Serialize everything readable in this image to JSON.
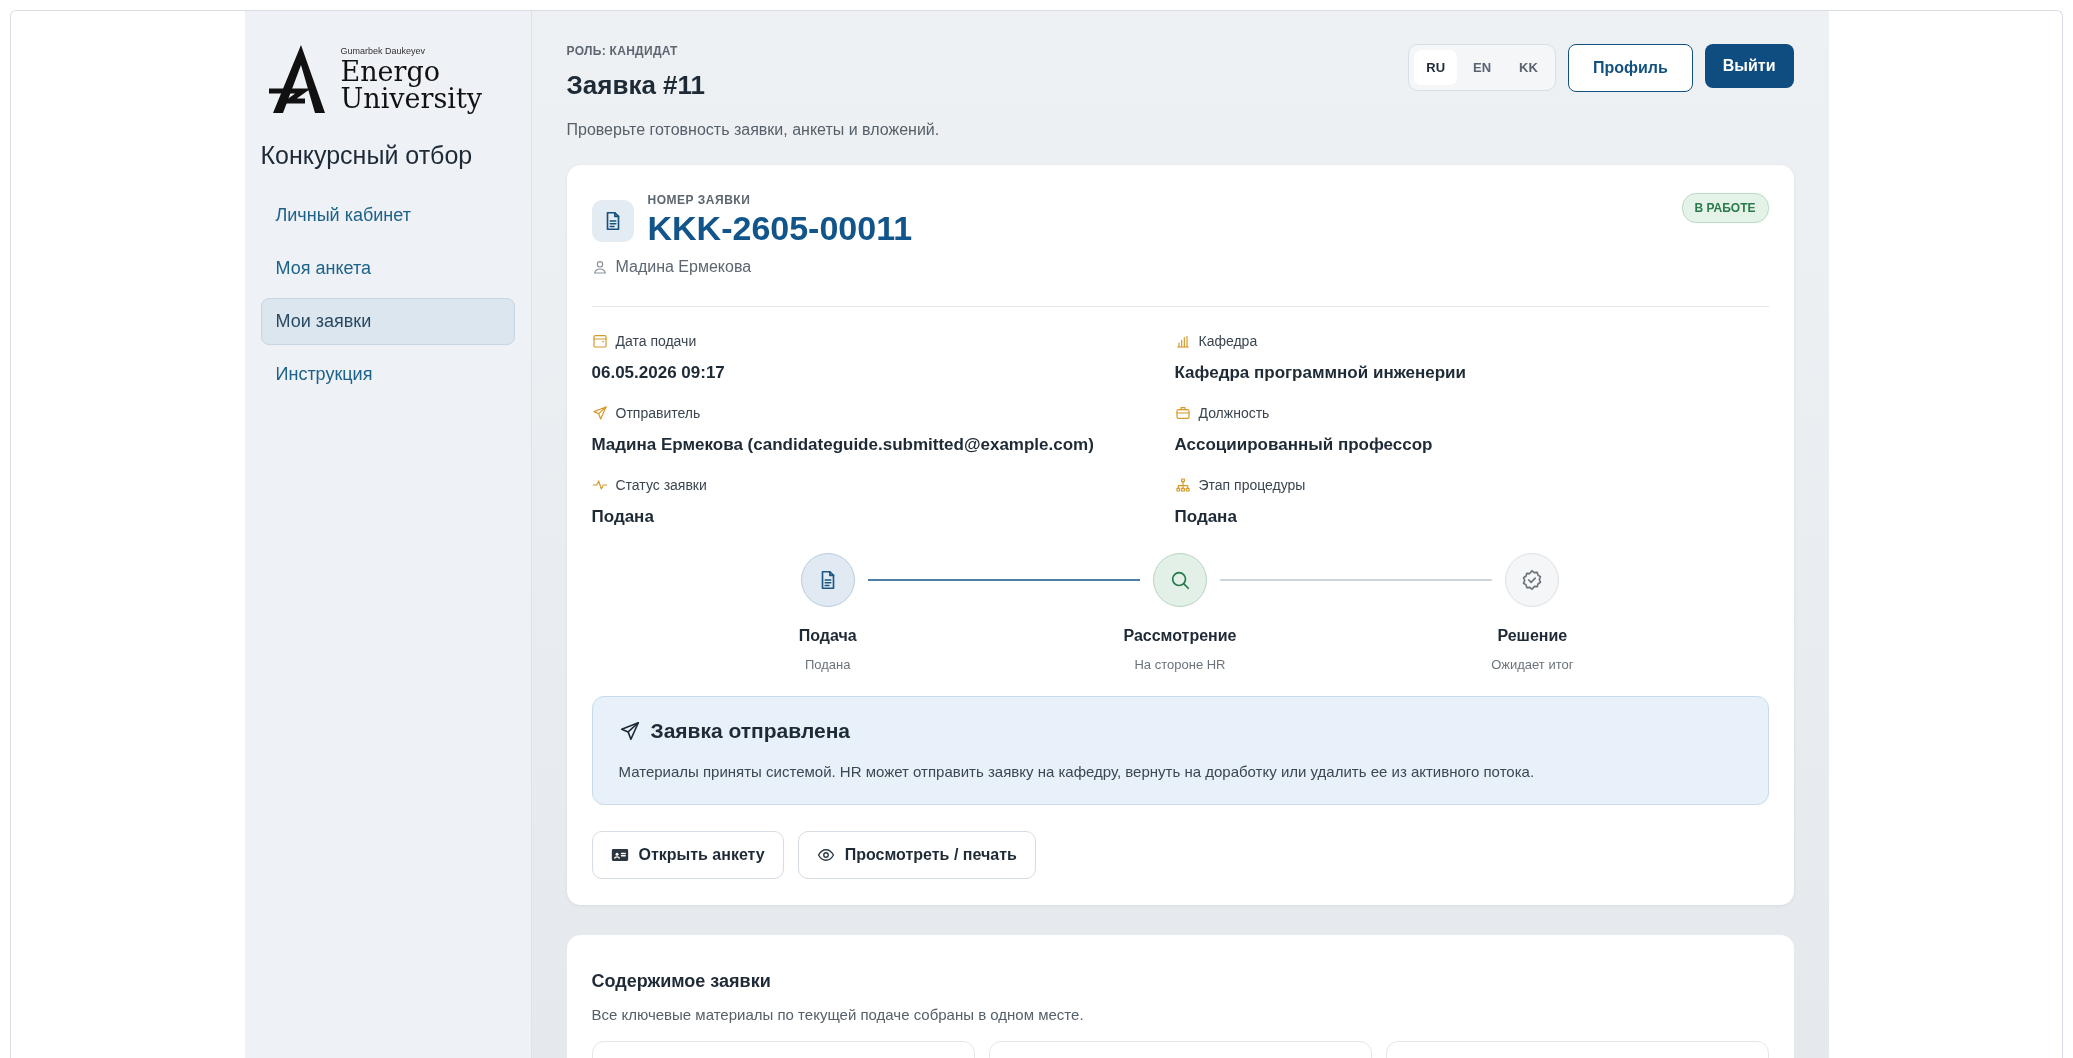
{
  "sidebar": {
    "logo": {
      "caption": "Gumarbek Daukeyev",
      "line1": "Energo",
      "line2": "University"
    },
    "title": "Конкурсный отбор",
    "items": [
      {
        "label": "Личный кабинет",
        "selected": false
      },
      {
        "label": "Моя анкета",
        "selected": false
      },
      {
        "label": "Мои заявки",
        "selected": true
      },
      {
        "label": "Инструкция",
        "selected": false
      }
    ]
  },
  "header": {
    "role": "РОЛЬ: КАНДИДАТ",
    "title": "Заявка #11",
    "subtitle": "Проверьте готовность заявки, анкеты и вложений.",
    "languages": [
      {
        "label": "RU",
        "selected": true
      },
      {
        "label": "EN",
        "selected": false
      },
      {
        "label": "KK",
        "selected": false
      }
    ],
    "profile_button": "Профиль",
    "logout_button": "Выйти"
  },
  "application": {
    "number_label": "НОМЕР ЗАЯВКИ",
    "number": "KKK-2605-00011",
    "applicant": "Мадина Ермекова",
    "status_badge": "В РАБОТЕ",
    "fields": [
      {
        "kind": "calendar",
        "label": "Дата подачи",
        "value": "06.05.2026 09:17"
      },
      {
        "kind": "building",
        "label": "Кафедра",
        "value": "Кафедра программной инженерии"
      },
      {
        "kind": "send",
        "label": "Отправитель",
        "value": "Мадина Ермекова (candidateguide.submitted@example.com)"
      },
      {
        "kind": "briefcase",
        "label": "Должность",
        "value": "Ассоциированный профессор"
      },
      {
        "kind": "pulse",
        "label": "Статус заявки",
        "value": "Подана"
      },
      {
        "kind": "hierarchy",
        "label": "Этап процедуры",
        "value": "Подана"
      }
    ],
    "steps": [
      {
        "kind": "document",
        "completed": true,
        "selected": false,
        "title": "Подача",
        "subtitle": "Подана"
      },
      {
        "kind": "search",
        "completed": false,
        "selected": true,
        "title": "Рассмотрение",
        "subtitle": "На стороне HR"
      },
      {
        "kind": "badge",
        "completed": false,
        "selected": false,
        "title": "Решение",
        "subtitle": "Ожидает итог"
      }
    ],
    "notice": {
      "title": "Заявка отправлена",
      "text": "Материалы приняты системой. HR может отправить заявку на кафедру, вернуть на доработку или удалить ее из активного потока."
    },
    "actions": [
      {
        "kind": "card",
        "label": "Открыть анкету"
      },
      {
        "kind": "eye",
        "label": "Просмотреть / печать"
      }
    ]
  },
  "contents": {
    "title": "Содержимое заявки",
    "subtitle": "Все ключевые материалы по текущей подаче собраны в одном месте."
  }
}
